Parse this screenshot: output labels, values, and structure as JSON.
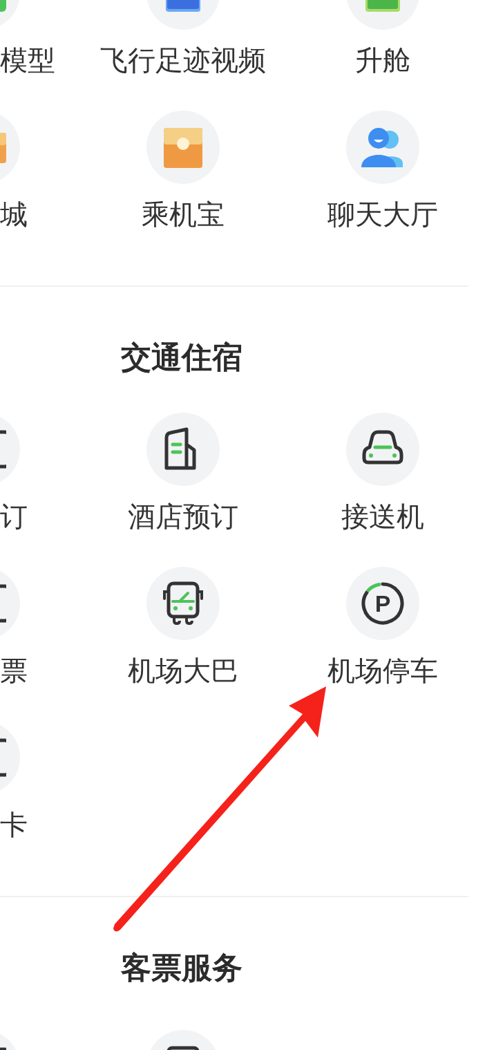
{
  "sections": [
    {
      "items": [
        {
          "kind": "entry",
          "label": "模型"
        },
        {
          "kind": "entry",
          "label": "飞行足迹视频"
        },
        {
          "kind": "entry",
          "label": "升舱"
        },
        {
          "kind": "entry",
          "label": "城"
        },
        {
          "kind": "entry",
          "label": "乘机宝"
        },
        {
          "kind": "entry",
          "label": "聊天大厅"
        }
      ]
    },
    {
      "title": "交通住宿",
      "items": [
        {
          "kind": "entry",
          "label": "订"
        },
        {
          "kind": "entry",
          "label": "酒店预订"
        },
        {
          "kind": "entry",
          "label": "接送机"
        },
        {
          "kind": "entry",
          "label": "票"
        },
        {
          "kind": "entry",
          "label": "机场大巴"
        },
        {
          "kind": "entry",
          "label": "机场停车",
          "icon_text": "P"
        },
        {
          "kind": "entry",
          "label": "卡"
        }
      ]
    },
    {
      "title": "客票服务",
      "items": [
        {
          "kind": "icon"
        },
        {
          "kind": "icon"
        }
      ]
    }
  ]
}
